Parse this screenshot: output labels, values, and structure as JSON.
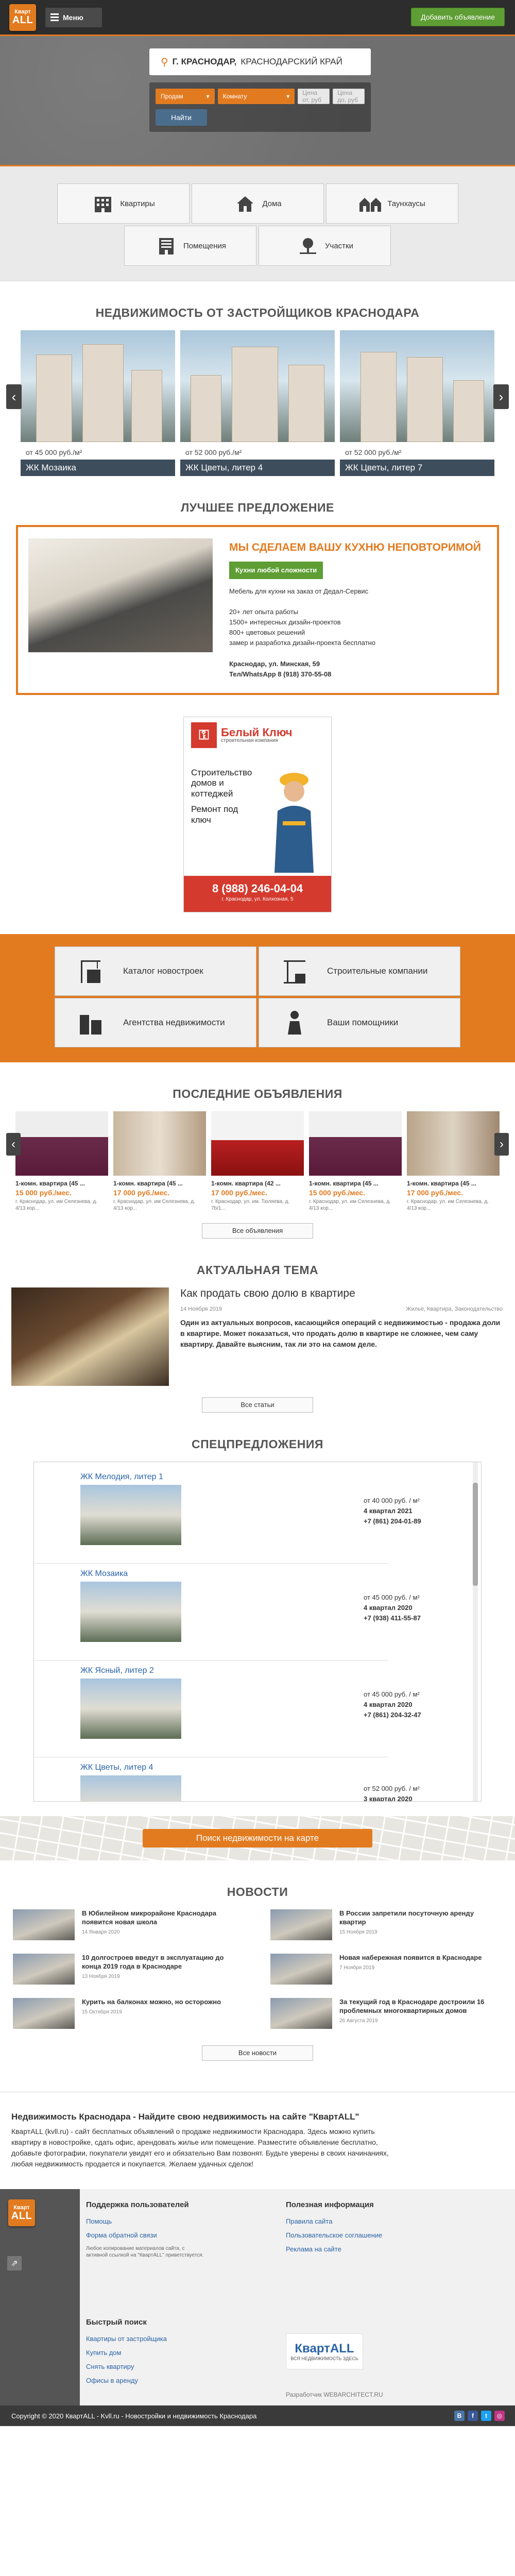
{
  "header": {
    "logo_line1": "Кварт",
    "logo_line2": "ALL",
    "menu_label": "Меню",
    "add_label": "Добавить объявление"
  },
  "hero": {
    "location_city": "Г. КРАСНОДАР,",
    "location_region": "КРАСНОДАРСКИЙ КРАЙ",
    "deal_select": "Продам",
    "type_select": "Комнату",
    "price_from_placeholder": "Цена от, руб",
    "price_to_placeholder": "Цена до, руб",
    "find_label": "Найти"
  },
  "categories": [
    {
      "label": "Квартиры",
      "icon": "apartment-building-icon"
    },
    {
      "label": "Дома",
      "icon": "house-icon"
    },
    {
      "label": "Таунхаусы",
      "icon": "townhouse-icon"
    },
    {
      "label": "Помещения",
      "icon": "office-building-icon"
    },
    {
      "label": "Участки",
      "icon": "tree-plot-icon"
    }
  ],
  "developers": {
    "title": "НЕДВИЖИМОСТЬ ОТ ЗАСТРОЙЩИКОВ КРАСНОДАРА",
    "items": [
      {
        "price": "от 45 000 руб./м²",
        "name": "ЖК Мозаика"
      },
      {
        "price": "от 52 000 руб./м²",
        "name": "ЖК Цветы, литер 4"
      },
      {
        "price": "от 52 000 руб./м²",
        "name": "ЖК Цветы, литер 7"
      }
    ]
  },
  "best": {
    "title": "ЛУЧШЕЕ ПРЕДЛОЖЕНИЕ",
    "heading": "МЫ СДЕЛАЕМ ВАШУ КУХНЮ НЕПОВТОРИМОЙ",
    "button": "Кухни любой сложности",
    "subtitle": "Мебель для кухни на заказ от Дедал-Сервис",
    "line1": "20+ лет опыта работы",
    "line2": "1500+ интересных дизайн-проектов",
    "line3": "800+ цветовых решений",
    "line4": "замер и разработка дизайн-проекта бесплатно",
    "address": "Краснодар, ул. Минская, 59",
    "phone": "Тел/WhatsApp   8 (918) 370-55-08"
  },
  "banner": {
    "brand": "Белый Ключ",
    "brand_sub": "строительная компания",
    "text1": "Строительство домов и коттеджей",
    "text2": "Ремонт под ключ",
    "phone": "8 (988) 246-04-04",
    "site": "г. Краснодар, ул. Колхозная, 5"
  },
  "quick_links": [
    {
      "label": "Каталог новостроек",
      "icon": "crane-building-icon"
    },
    {
      "label": "Строительные компании",
      "icon": "construction-crane-icon"
    },
    {
      "label": "Агентства недвижимости",
      "icon": "agency-buildings-icon"
    },
    {
      "label": "Ваши помощники",
      "icon": "helper-person-icon"
    }
  ],
  "latest": {
    "title": "ПОСЛЕДНИЕ ОБЪЯВЛЕНИЯ",
    "items": [
      {
        "title": "1-комн. квартира (45 ...",
        "price": "15 000 руб./мес.",
        "addr": "г. Краснодар, ул. им Селезнева, д. 4/13 кор..."
      },
      {
        "title": "1-комн. квартира (45 ...",
        "price": "17 000 руб./мес.",
        "addr": "г. Краснодар, ул. им Селезнева, д. 4/13 кор..."
      },
      {
        "title": "1-комн. квартира (42 ...",
        "price": "17 000 руб./мес.",
        "addr": "г. Краснодар, ул. им. Тюляева, д. 7b/1..."
      },
      {
        "title": "1-комн. квартира (45 ...",
        "price": "15 000 руб./мес.",
        "addr": "г. Краснодар, ул. им Селезнева, д. 4/13 кор..."
      },
      {
        "title": "1-комн. квартира (45 ...",
        "price": "17 000 руб./мес.",
        "addr": "г. Краснодар, ул. им Селезнева, д. 4/13 кор..."
      }
    ],
    "all_label": "Все объявления"
  },
  "topic": {
    "title": "АКТУАЛЬНАЯ ТЕМА",
    "heading": "Как продать свою долю в квартире",
    "date": "14 Ноября 2019",
    "tags": "Жилье, Квартира, Законодательство",
    "body": "Один из актуальных вопросов, касающийся операций с недвижимостью - продажа доли в квартире. Может показаться, что продать долю в квартире не сложнее, чем саму квартиру. Давайте выясним, так ли это на самом деле.",
    "all_label": "Все статьи"
  },
  "special": {
    "title": "СПЕЦПРЕДЛОЖЕНИЯ",
    "items": [
      {
        "name": "ЖК Мелодия, литер 1",
        "price": "от 40 000 руб. / м²",
        "date": "4 квартал 2021",
        "phone": "+7 (861) 204-01-89"
      },
      {
        "name": "ЖК Мозаика",
        "price": "от 45 000 руб. / м²",
        "date": "4 квартал 2020",
        "phone": "+7 (938) 411-55-87"
      },
      {
        "name": "ЖК Ясный, литер 2",
        "price": "от 45 000 руб. / м²",
        "date": "4 квартал 2020",
        "phone": "+7 (861) 204-32-47"
      },
      {
        "name": "ЖК Цветы, литер 4",
        "price": "от 52 000 руб. / м²",
        "date": "3 квартал 2020",
        "phone": ""
      }
    ]
  },
  "map": {
    "button": "Поиск недвижимости на карте"
  },
  "news": {
    "title": "НОВОСТИ",
    "items": [
      {
        "title": "В Юбилейном микрорайоне Краснодара появится новая школа",
        "date": "14 Января 2020"
      },
      {
        "title": "В России запретили посуточную аренду квартир",
        "date": "15 Ноября 2019"
      },
      {
        "title": "10 долгостроев введут в эксплуатацию до конца 2019 года в Краснодаре",
        "date": "13 Ноября 2019"
      },
      {
        "title": "Новая набережная появится в Краснодаре",
        "date": "7 Ноября 2019"
      },
      {
        "title": "Курить на балконах можно, но осторожно",
        "date": "15 Октября 2019"
      },
      {
        "title": "За текущий год в Краснодаре достроили 16 проблемных многоквартирных домов",
        "date": "26 Августа 2019"
      }
    ],
    "all_label": "Все новости"
  },
  "about": {
    "heading": "Недвижимость Краснодара - Найдите свою недвижимость на сайте \"КвартALL\"",
    "text": "КвартALL (kvll.ru) - сайт бесплатных объявлений о продаже недвижимости Краснодара. Здесь можно купить квартиру в новостройке, сдать офис, арендовать жилье или помещение. Разместите объявление бесплатно, добавьте фотографии, покупатели увидят его и обязательно Вам позвонят. Будьте уверены в своих начинаниях, любая недвижимость продается и покупается. Желаем удачных сделок!"
  },
  "footer": {
    "support_title": "Поддержка пользователей",
    "support_links": [
      "Помощь",
      "Форма обратной связи"
    ],
    "copy_note": "Любое копирование материалов сайта, с активной ссылкой на \"КвартALL\" приветствуется.",
    "info_title": "Полезная информация",
    "info_links": [
      "Правила сайта",
      "Пользовательское соглашение",
      "Реклама на сайте"
    ],
    "quick_title": "Быстрый поиск",
    "quick_links": [
      "Квартиры от застройщика",
      "Купить дом",
      "Снять квартиру",
      "Офисы в аренду"
    ],
    "badge_big": "КвартALL",
    "badge_small": "ВСЯ НЕДВИЖИМОСТЬ ЗДЕСЬ",
    "developer": "Разработчик  WEBARCHITECT.RU",
    "copyright": "Copyright © 2020 КвартALL - Kvll.ru - Новостройки и недвижимость Краснодара"
  },
  "colors": {
    "accent": "#e27b20",
    "green": "#5e9e34",
    "dark": "#2d2d2d",
    "link": "#2a63a6"
  }
}
